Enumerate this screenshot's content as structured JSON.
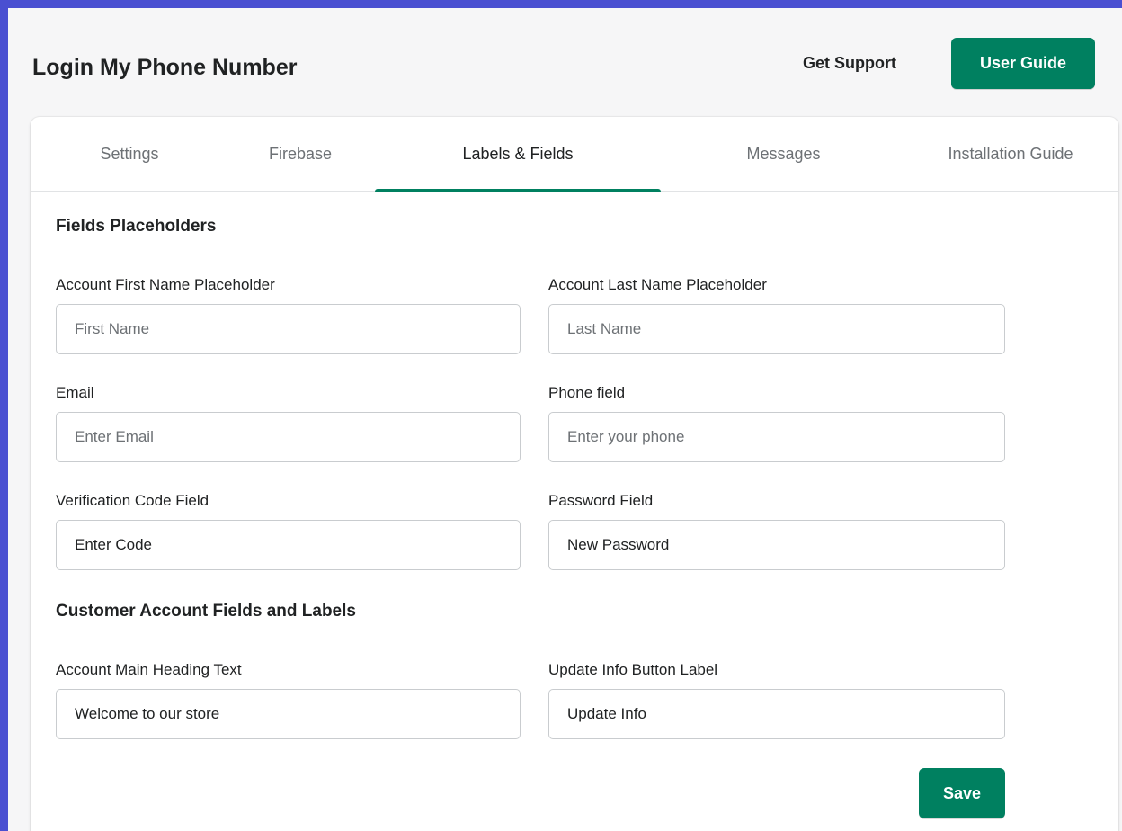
{
  "header": {
    "title": "Login My Phone Number",
    "get_support_label": "Get Support",
    "user_guide_label": "User Guide"
  },
  "tabs": [
    {
      "label": "Settings",
      "active": false
    },
    {
      "label": "Firebase",
      "active": false
    },
    {
      "label": "Labels & Fields",
      "active": true
    },
    {
      "label": "Messages",
      "active": false
    },
    {
      "label": "Installation Guide",
      "active": false
    }
  ],
  "fields_placeholders": {
    "heading": "Fields Placeholders",
    "first_name": {
      "label": "Account First Name Placeholder",
      "value": "",
      "placeholder": "First Name"
    },
    "last_name": {
      "label": "Account Last Name Placeholder",
      "value": "",
      "placeholder": "Last Name"
    },
    "email": {
      "label": "Email",
      "value": "",
      "placeholder": "Enter Email"
    },
    "phone": {
      "label": "Phone field",
      "value": "",
      "placeholder": "Enter your phone"
    },
    "verification_code": {
      "label": "Verification Code Field",
      "value": "Enter Code",
      "placeholder": ""
    },
    "password": {
      "label": "Password Field",
      "value": "New Password",
      "placeholder": ""
    }
  },
  "customer_account": {
    "heading": "Customer Account Fields and Labels",
    "main_heading": {
      "label": "Account Main Heading Text",
      "value": "Welcome to our store"
    },
    "update_button": {
      "label": "Update Info Button Label",
      "value": "Update Info"
    }
  },
  "save_label": "Save",
  "colors": {
    "accent": "#008060",
    "frame_border": "#4a4fd1",
    "background": "#f6f6f7"
  }
}
